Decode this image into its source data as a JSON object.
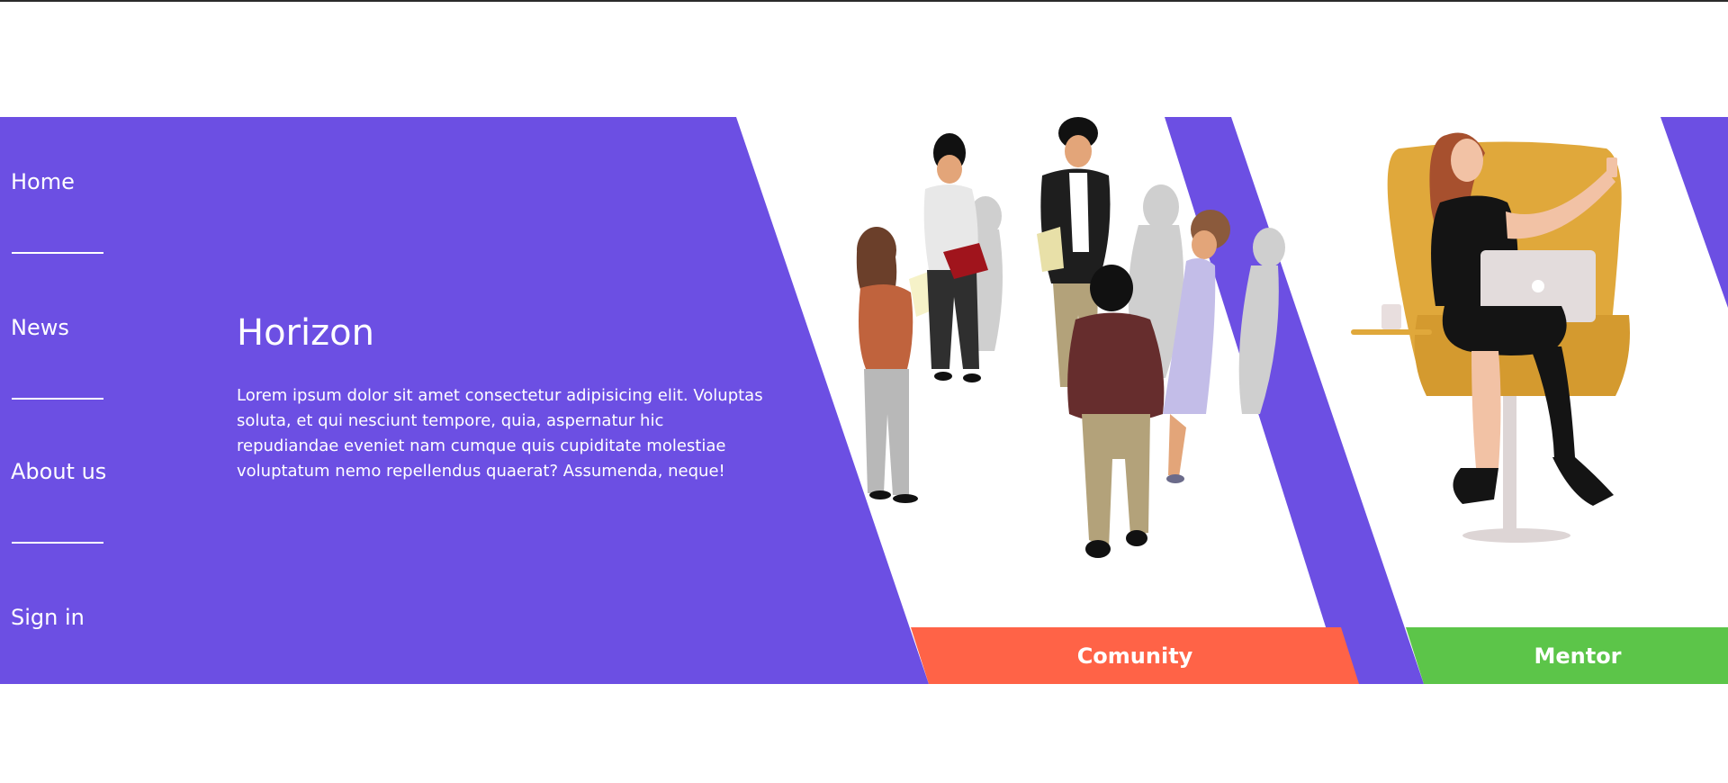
{
  "nav": {
    "items": [
      {
        "label": "Home"
      },
      {
        "label": "News"
      },
      {
        "label": "About us"
      },
      {
        "label": "Sign in"
      }
    ]
  },
  "hero": {
    "title": "Horizon",
    "body": "Lorem ipsum dolor sit amet consectetur adipisicing elit. Voluptas soluta, et qui nesciunt tempore, quia, aspernatur hic repudiandae eveniet nam cumque quis cupiditate molestiae voluptatum nemo repellendus quaerat? Assumenda, neque!"
  },
  "cards": [
    {
      "label": "Comunity",
      "color": "#ff6347"
    },
    {
      "label": "Mentor",
      "color": "#5cc549"
    }
  ],
  "colors": {
    "brand": "#6c4fe3",
    "white": "#ffffff"
  }
}
